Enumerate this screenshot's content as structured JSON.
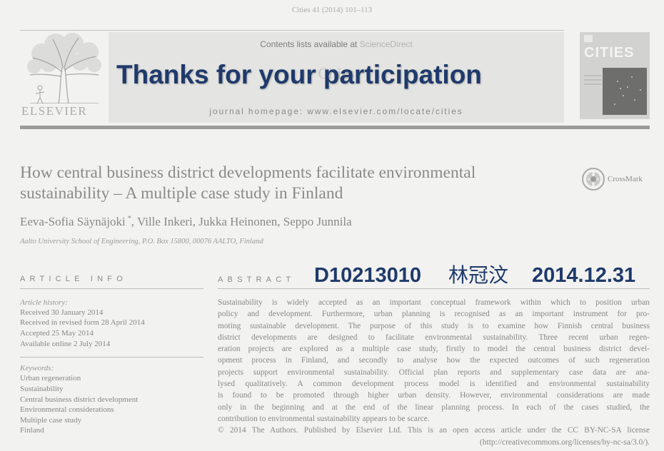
{
  "citation": "Cities 41 (2014) 101–113",
  "header": {
    "publisher": "ELSEVIER",
    "contents_prefix": "Contents lists available at",
    "contents_link": "ScienceDirect",
    "journal": "Cities",
    "homepage_prefix": "journal homepage:",
    "homepage_url": "www.elsevier.com/locate/cities",
    "cover_title": "CITIES"
  },
  "overlay": {
    "thanks": "Thanks for your participation",
    "student_id": "D10213010",
    "name": "林冠汶",
    "date": "2014.12.31"
  },
  "article": {
    "title_lines": [
      "How central business district developments facilitate environmental",
      "sustainability – A multiple case study in Finland"
    ],
    "first_author": "Eeva-Sofia Säynäjoki",
    "corresponding_mark": "*",
    "other_authors": ", Ville Inkeri, Jukka Heinonen, Seppo Junnila",
    "affiliation": "Aalto University School of Engineering, P.O. Box 15800, 00076 AALTO, Finland",
    "crossmark_label": "CrossMark"
  },
  "article_info": {
    "heading": "ARTICLE INFO",
    "history_label": "Article history:",
    "history": [
      "Received 30 January 2014",
      "Received in revised form 28 April 2014",
      "Accepted 25 May 2014",
      "Available online 2 July 2014"
    ],
    "keywords_label": "Keywords:",
    "keywords": [
      "Urban regeneration",
      "Sustainability",
      "Central business district development",
      "Environmental considerations",
      "Multiple case study",
      "Finland"
    ]
  },
  "abstract": {
    "heading": "ABSTRACT",
    "lines": [
      "Sustainability is widely accepted as an important conceptual framework within which to position urban",
      "policy and development. Furthermore, urban planning is recognised as an important instrument for pro-",
      "moting sustainable development. The purpose of this study is to examine how Finnish central business",
      "district developments are designed to facilitate environmental sustainability. Three recent urban regen-",
      "eration projects are explored as a multiple case study, firstly to model the central business district devel-",
      "opment process in Finland, and secondly to analyse how the expected outcomes of such regeneration",
      "projects support environmental sustainability. Official plan reports and supplementary case data are ana-",
      "lysed qualitatively. A common development process model is identified and environmental sustainability",
      "is found to be promoted through higher urban density. However, environmental considerations are made",
      "only in the beginning and at the end of the linear planning process. In each of the cases studied, the",
      "contribution to environmental sustainability appears to be scarce."
    ],
    "copyright": "© 2014 The Authors. Published by Elsevier Ltd. This is an open access article under the CC BY-NC-SA license",
    "license_url": "(http://creativecommons.org/licenses/by-nc-sa/3.0/)."
  },
  "icons": {
    "publisher_logo": "elsevier-tree-icon",
    "crossmark": "crossmark-icon"
  },
  "colors": {
    "page_background": "#f2f2f0",
    "text_gray": "#8a8a88",
    "overlay_navy": "#1f3a6b",
    "banner_background": "#e4e4e2"
  }
}
